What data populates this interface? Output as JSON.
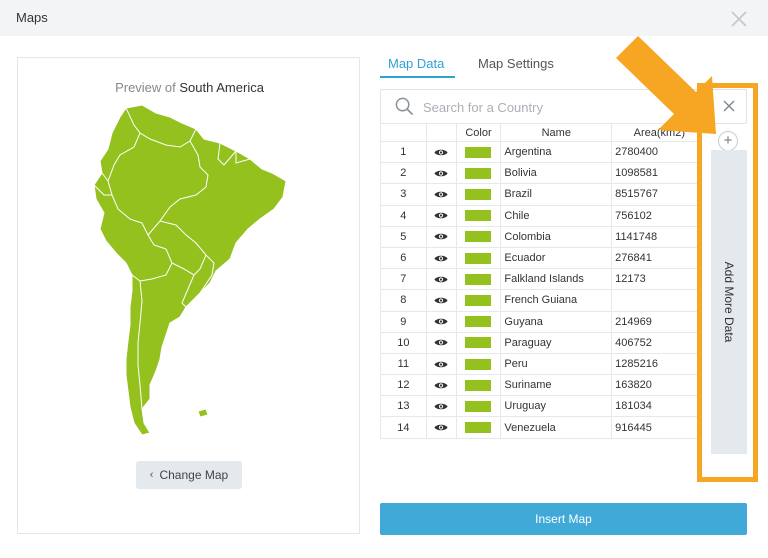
{
  "dialog": {
    "title": "Maps"
  },
  "preview": {
    "label_prefix": "Preview of",
    "region_name": "South America",
    "map_color": "#95c11f",
    "change_map_label": "Change Map"
  },
  "tabs": [
    {
      "label": "Map Data",
      "active": true
    },
    {
      "label": "Map Settings",
      "active": false
    }
  ],
  "search": {
    "placeholder": "Search for a Country",
    "value": ""
  },
  "table": {
    "headers": {
      "color": "Color",
      "name": "Name",
      "area": "Area(km2)"
    },
    "rows": [
      {
        "index": "1",
        "name": "Argentina",
        "area": "2780400",
        "color": "#95c11f"
      },
      {
        "index": "2",
        "name": "Bolivia",
        "area": "1098581",
        "color": "#95c11f"
      },
      {
        "index": "3",
        "name": "Brazil",
        "area": "8515767",
        "color": "#95c11f"
      },
      {
        "index": "4",
        "name": "Chile",
        "area": "756102",
        "color": "#95c11f"
      },
      {
        "index": "5",
        "name": "Colombia",
        "area": "1141748",
        "color": "#95c11f"
      },
      {
        "index": "6",
        "name": "Ecuador",
        "area": "276841",
        "color": "#95c11f"
      },
      {
        "index": "7",
        "name": "Falkland Islands",
        "area": "12173",
        "color": "#95c11f"
      },
      {
        "index": "8",
        "name": "French Guiana",
        "area": "",
        "color": "#95c11f"
      },
      {
        "index": "9",
        "name": "Guyana",
        "area": "214969",
        "color": "#95c11f"
      },
      {
        "index": "10",
        "name": "Paraguay",
        "area": "406752",
        "color": "#95c11f"
      },
      {
        "index": "11",
        "name": "Peru",
        "area": "1285216",
        "color": "#95c11f"
      },
      {
        "index": "12",
        "name": "Suriname",
        "area": "163820",
        "color": "#95c11f"
      },
      {
        "index": "13",
        "name": "Uruguay",
        "area": "181034",
        "color": "#95c11f"
      },
      {
        "index": "14",
        "name": "Venezuela",
        "area": "916445",
        "color": "#95c11f"
      }
    ]
  },
  "add_more": {
    "label": "Add More Data",
    "icon": "plus-icon"
  },
  "actions": {
    "insert_label": "Insert Map"
  },
  "colors": {
    "accent": "#2ea3d3",
    "insert_button": "#40a9d8",
    "highlight": "#f6a623"
  }
}
